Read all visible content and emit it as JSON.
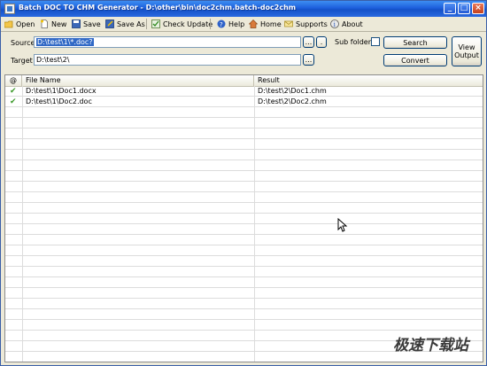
{
  "window": {
    "title": "Batch DOC TO CHM Generator - D:\\other\\bin\\doc2chm.batch-doc2chm",
    "min_glyph": "_",
    "max_glyph": "□",
    "close_glyph": "×"
  },
  "toolbar": {
    "items": [
      {
        "label": "Open",
        "icon": "open-folder-icon"
      },
      {
        "label": "New",
        "icon": "new-file-icon"
      },
      {
        "label": "Save",
        "icon": "save-disk-icon"
      },
      {
        "label": "Save As",
        "icon": "save-as-icon"
      },
      {
        "label": "Check Update",
        "icon": "check-update-icon"
      },
      {
        "label": "Help",
        "icon": "help-icon"
      },
      {
        "label": "Home",
        "icon": "home-icon"
      },
      {
        "label": "Supports",
        "icon": "supports-icon"
      },
      {
        "label": "About",
        "icon": "about-icon"
      }
    ]
  },
  "form": {
    "source_label": "Source",
    "source_value": "D:\\test\\1\\*.doc?",
    "target_label": "Target",
    "target_value": "D:\\test\\2\\",
    "browse_label": "...",
    "dot_label": ".",
    "subfolders_label": "Sub folders",
    "subfolders_checked": false,
    "search_label": "Search",
    "convert_label": "Convert",
    "view_output_label_1": "View",
    "view_output_label_2": "Output"
  },
  "table": {
    "columns": {
      "status": "@",
      "file_name": "File Name",
      "result": "Result"
    },
    "rows": [
      {
        "status": "✔",
        "file_name": "D:\\test\\1\\Doc1.docx",
        "result": "D:\\test\\2\\Doc1.chm"
      },
      {
        "status": "✔",
        "file_name": "D:\\test\\1\\Doc2.doc",
        "result": "D:\\test\\2\\Doc2.chm"
      }
    ]
  },
  "watermark": "极速下载站",
  "colors": {
    "titlebar": "#1d5fdc",
    "selection": "#3169c6",
    "check": "#3c9a2a",
    "window_bg": "#ece9d8"
  }
}
